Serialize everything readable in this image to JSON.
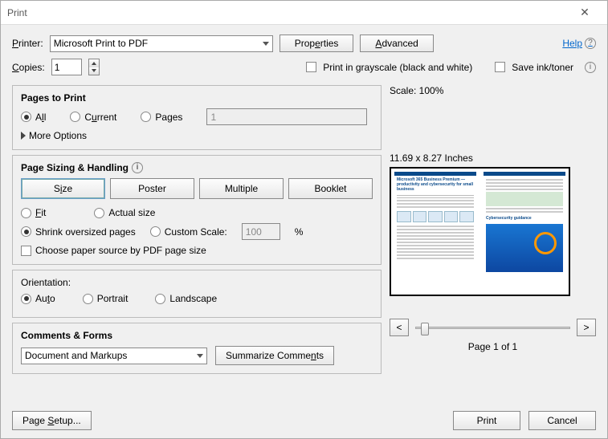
{
  "title": "Print",
  "help": "Help",
  "printer": {
    "label": "Printer:",
    "value": "Microsoft Print to PDF",
    "properties": "Properties",
    "advanced": "Advanced"
  },
  "copies": {
    "label": "Copies:",
    "value": "1"
  },
  "grayscale": "Print in grayscale (black and white)",
  "saveink": "Save ink/toner",
  "pages": {
    "title": "Pages to Print",
    "all": "All",
    "current": "Current",
    "pages": "Pages",
    "pages_value": "1",
    "more": "More Options"
  },
  "sizing": {
    "title": "Page Sizing & Handling",
    "size": "Size",
    "poster": "Poster",
    "multiple": "Multiple",
    "booklet": "Booklet",
    "fit": "Fit",
    "actual": "Actual size",
    "shrink": "Shrink oversized pages",
    "custom": "Custom Scale:",
    "custom_value": "100",
    "pct": "%",
    "choose_paper": "Choose paper source by PDF page size"
  },
  "orientation": {
    "title": "Orientation:",
    "auto": "Auto",
    "portrait": "Portrait",
    "landscape": "Landscape"
  },
  "comments": {
    "title": "Comments & Forms",
    "value": "Document and Markups",
    "summarize": "Summarize Comments"
  },
  "preview": {
    "scale": "Scale: 100%",
    "dims": "11.69 x 8.27 Inches",
    "prev": "<",
    "next": ">",
    "page_of": "Page 1 of 1",
    "doc_title": "Microsoft 365 Business Premium — productivity and cybersecurity for small business",
    "sub_title": "Cybersecurity guidance"
  },
  "footer": {
    "page_setup": "Page Setup...",
    "print": "Print",
    "cancel": "Cancel"
  }
}
